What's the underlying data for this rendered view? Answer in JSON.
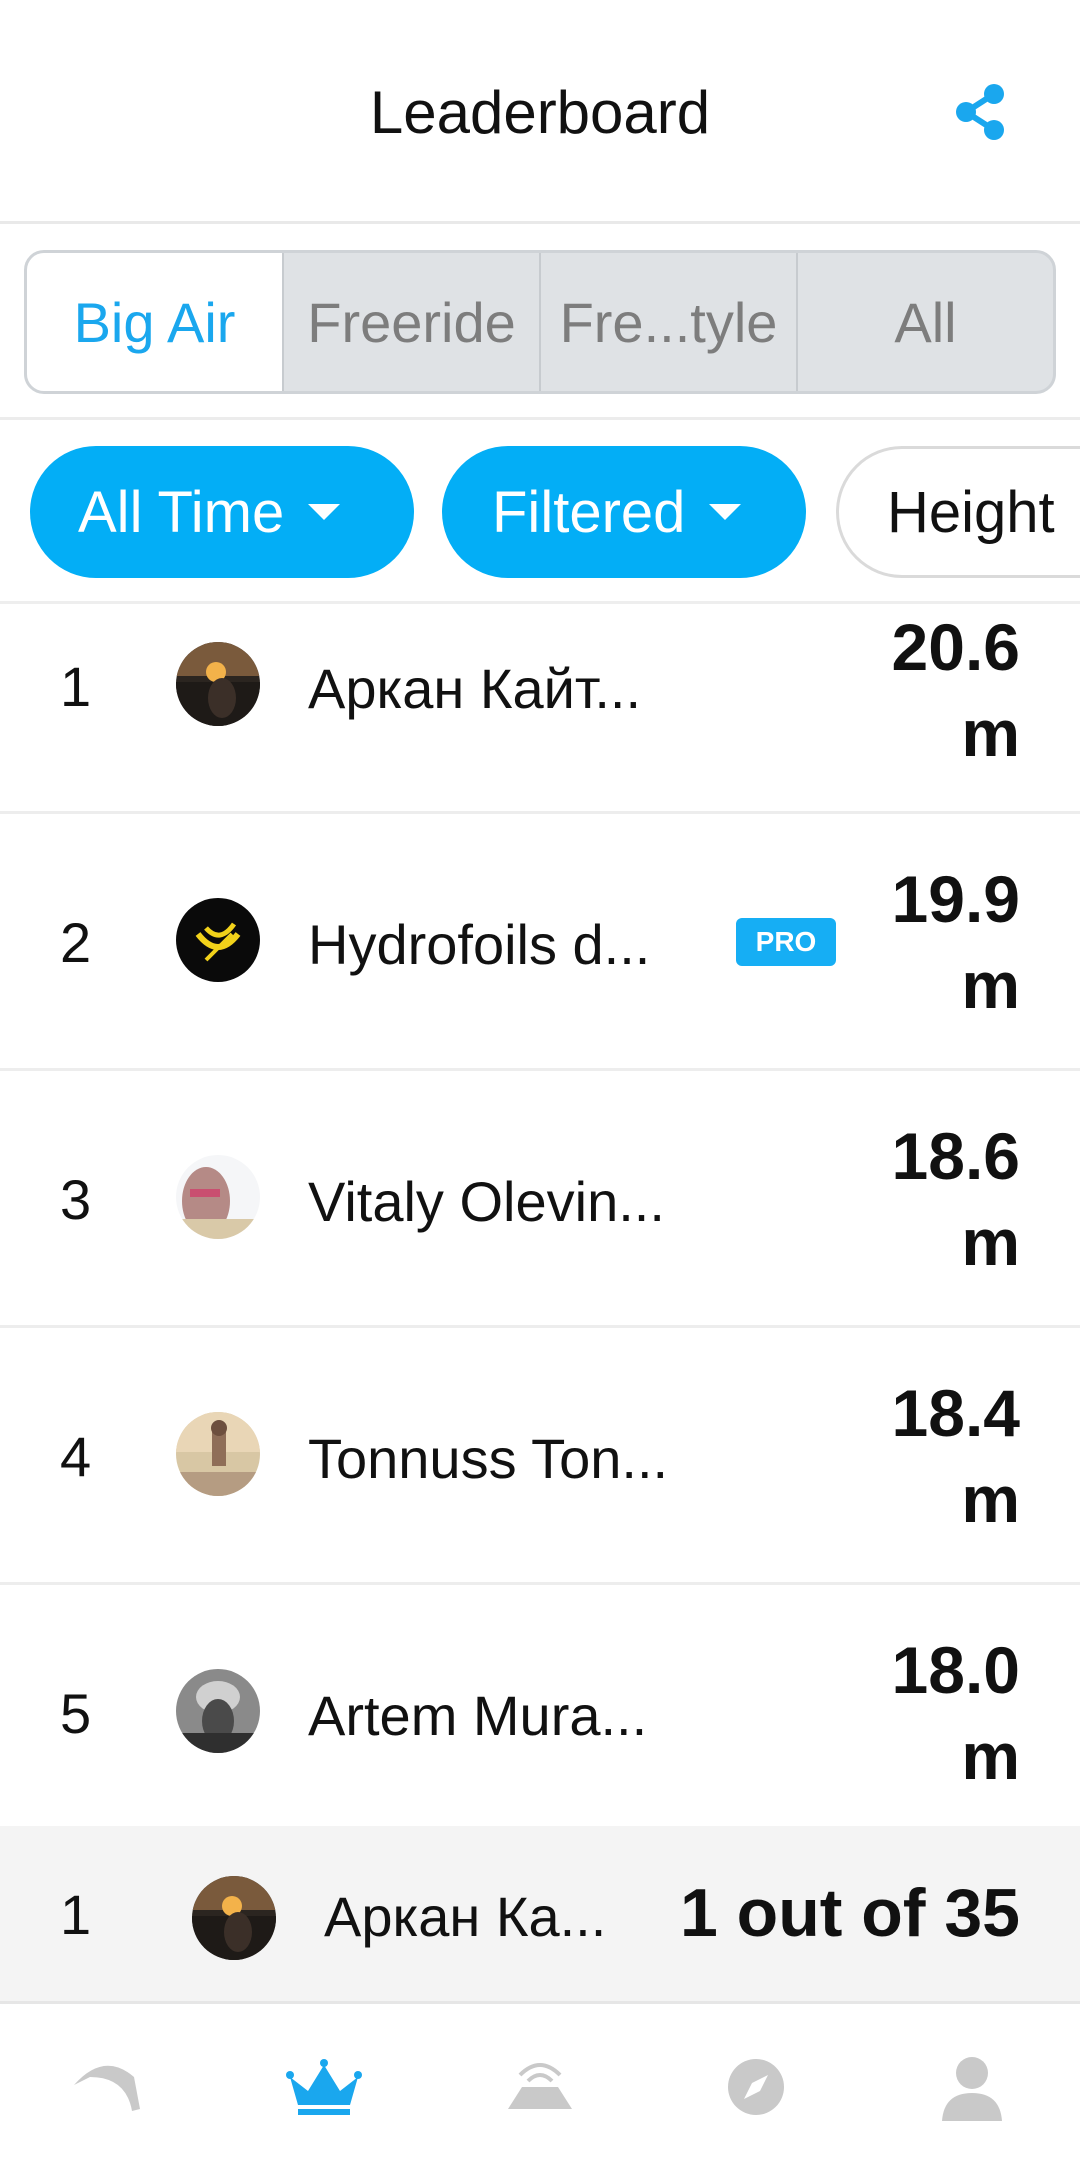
{
  "header": {
    "title": "Leaderboard"
  },
  "tabs": [
    {
      "label": "Big Air",
      "active": true
    },
    {
      "label": "Freeride",
      "active": false
    },
    {
      "label": "Fre...tyle",
      "active": false
    },
    {
      "label": "All",
      "active": false
    }
  ],
  "filters": {
    "time": "All Time",
    "filter": "Filtered",
    "metric": "Height"
  },
  "rows": [
    {
      "rank": "1",
      "name": "Аркан Кайт...",
      "pro": false,
      "value": "20.6",
      "unit": "m"
    },
    {
      "rank": "2",
      "name": "Hydrofoils d...",
      "pro": true,
      "pro_label": "PRO",
      "value": "19.9",
      "unit": "m"
    },
    {
      "rank": "3",
      "name": "Vitaly Olevin...",
      "pro": false,
      "value": "18.6",
      "unit": "m"
    },
    {
      "rank": "4",
      "name": "Tonnuss Ton...",
      "pro": false,
      "value": "18.4",
      "unit": "m"
    },
    {
      "rank": "5",
      "name": "Artem Mura...",
      "pro": false,
      "value": "18.0",
      "unit": "m"
    }
  ],
  "current_user": {
    "rank": "1",
    "name": "Аркан Ка...",
    "position": "1 out of 35"
  },
  "nav": [
    "kite-icon",
    "crown-icon",
    "session-icon",
    "compass-icon",
    "profile-icon"
  ],
  "colors": {
    "accent": "#03aef6",
    "active_tab_text": "#1aa7ee",
    "nav_inactive": "#c9c9c9"
  }
}
